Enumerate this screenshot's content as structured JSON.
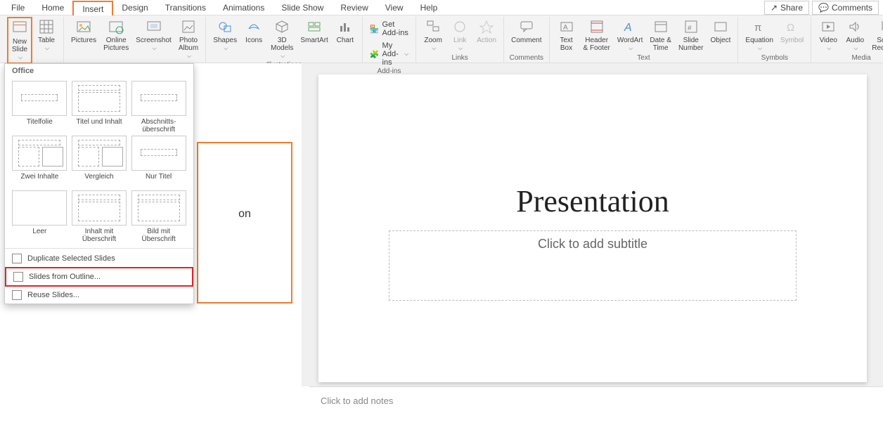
{
  "menu": {
    "tabs": [
      "File",
      "Home",
      "Insert",
      "Design",
      "Transitions",
      "Animations",
      "Slide Show",
      "Review",
      "View",
      "Help"
    ],
    "active": "Insert",
    "share": "Share",
    "comments": "Comments"
  },
  "ribbon": {
    "slides": {
      "new_slide": "New\nSlide",
      "table": "Table"
    },
    "images": {
      "pictures": "Pictures",
      "online": "Online\nPictures",
      "screenshot": "Screenshot",
      "album": "Photo\nAlbum"
    },
    "illus": {
      "label": "Illustrations",
      "shapes": "Shapes",
      "icons": "Icons",
      "models": "3D\nModels",
      "smartart": "SmartArt",
      "chart": "Chart"
    },
    "addins": {
      "label": "Add-ins",
      "get": "Get Add-ins",
      "my": "My Add-ins"
    },
    "links": {
      "label": "Links",
      "zoom": "Zoom",
      "link": "Link",
      "action": "Action"
    },
    "comments": {
      "label": "Comments",
      "comment": "Comment"
    },
    "text": {
      "label": "Text",
      "textbox": "Text\nBox",
      "header": "Header\n& Footer",
      "wordart": "WordArt",
      "date": "Date &\nTime",
      "slidenum": "Slide\nNumber",
      "object": "Object"
    },
    "symbols": {
      "label": "Symbols",
      "equation": "Equation",
      "symbol": "Symbol"
    },
    "media": {
      "label": "Media",
      "video": "Video",
      "audio": "Audio",
      "screen": "Screen\nRecording"
    }
  },
  "dropdown": {
    "header": "Office",
    "layouts": [
      {
        "label": "Titelfolie"
      },
      {
        "label": "Titel und Inhalt"
      },
      {
        "label": "Abschnitts-\nüberschrift"
      },
      {
        "label": "Zwei Inhalte"
      },
      {
        "label": "Vergleich"
      },
      {
        "label": "Nur Titel"
      },
      {
        "label": "Leer"
      },
      {
        "label": "Inhalt mit\nÜberschrift"
      },
      {
        "label": "Bild mit\nÜberschrift"
      }
    ],
    "dup": "Duplicate Selected Slides",
    "outline": "Slides from Outline...",
    "reuse": "Reuse Slides..."
  },
  "slide": {
    "thumb_text": "on",
    "title": "Presentation",
    "subtitle": "Click to add subtitle"
  },
  "notes": "Click to add notes",
  "colors": {
    "accent": "#ed7d31",
    "highlight": "#d9252a"
  }
}
